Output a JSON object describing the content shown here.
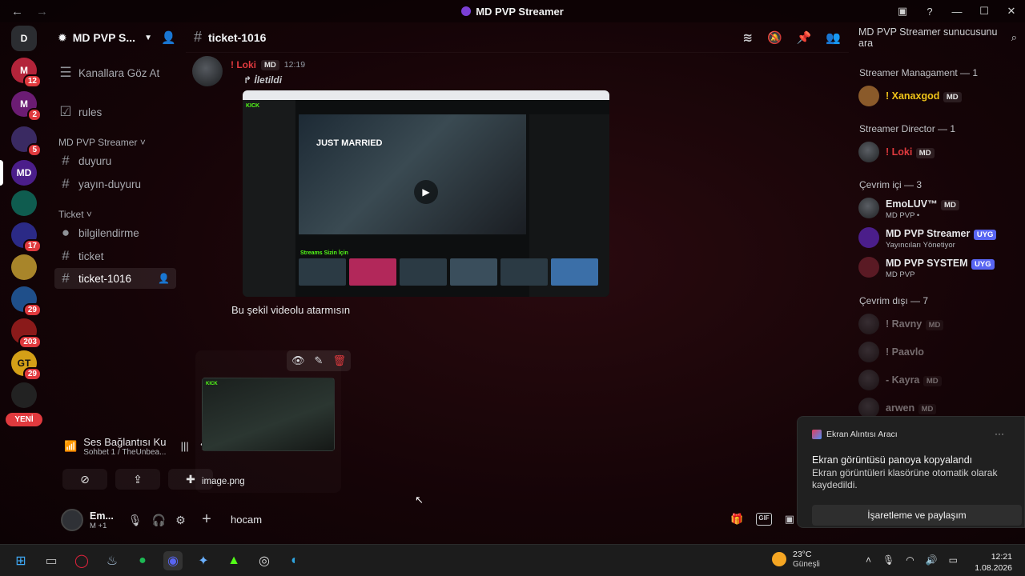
{
  "window": {
    "title": "MD PVP Streamer",
    "back_icon": "←",
    "forward_icon": "→",
    "inbox_icon": "▣",
    "help_icon": "?",
    "minimize": "—",
    "maximize": "☐",
    "close": "✕"
  },
  "rail": {
    "servers": [
      {
        "name": "server-home",
        "label": "D",
        "badge": ""
      },
      {
        "name": "server-m1",
        "label": "M",
        "badge": "12"
      },
      {
        "name": "server-m2",
        "label": "M",
        "badge": "2"
      },
      {
        "name": "server-3",
        "label": "",
        "badge": "5"
      },
      {
        "name": "server-md",
        "label": "MD",
        "badge": ""
      },
      {
        "name": "server-5",
        "label": "",
        "badge": ""
      },
      {
        "name": "server-6",
        "label": "",
        "badge": "17"
      },
      {
        "name": "server-7",
        "label": "",
        "badge": ""
      },
      {
        "name": "server-8",
        "label": "",
        "badge": "29"
      },
      {
        "name": "server-anadolu",
        "label": "",
        "badge": "203"
      },
      {
        "name": "server-gt",
        "label": "GT",
        "badge": "29"
      },
      {
        "name": "server-11",
        "label": "",
        "badge": ""
      }
    ],
    "new_label": "YENİ"
  },
  "sidebar": {
    "guild_name": "MD PVP S...",
    "browse": "Kanallara Göz At",
    "rules": "rules",
    "cat1": "MD PVP Streamer",
    "ch_duyuru": "duyuru",
    "ch_yayin": "yayın-duyuru",
    "cat2": "Ticket",
    "ch_bilgi": "bilgilendirme",
    "ch_ticket": "ticket",
    "ch_ticket1016": "ticket-1016"
  },
  "voice": {
    "title": "Ses Bağlantısı Ku",
    "subtitle": "Sohbet 1 / TheUnbea..."
  },
  "user": {
    "name": "Em...",
    "status": "M +1"
  },
  "chat": {
    "channel": "ticket-1016",
    "message": {
      "author": "! Loki",
      "tag": "MD",
      "time": "12:19",
      "forwarded": "↱ İletildi",
      "text": "Bu şekil videolu atarmısın"
    },
    "shot": {
      "brand": "KICK",
      "hero": "JUST MARRIED",
      "play": "▶",
      "streams": "Streams Sizin İçin"
    },
    "attachment": {
      "filename": "image.png",
      "brand": "KICK"
    },
    "composer": {
      "value": "hocam ",
      "plus": "+",
      "gif": "GIF"
    }
  },
  "search": {
    "placeholder": "MD PVP Streamer sunucusunu ara"
  },
  "members": {
    "cat_management": "Streamer Managament — 1",
    "m1": {
      "name": "! Xanaxgod",
      "tag": "MD"
    },
    "cat_director": "Streamer Director — 1",
    "m2": {
      "name": "! Loki",
      "tag": "MD"
    },
    "cat_online": "Çevrim içi — 3",
    "m3": {
      "name": "EmoLUV™",
      "tag": "MD",
      "sub": "MD PVP •"
    },
    "m4": {
      "name": "MD PVP Streamer",
      "tag": "UYG",
      "sub": "Yayıncıları Yönetiyor"
    },
    "m5": {
      "name": "MD PVP SYSTEM",
      "tag": "UYG",
      "sub": "MD PVP"
    },
    "cat_offline": "Çevrim dışı — 7",
    "m6": {
      "name": "! Ravny",
      "tag": "MD"
    },
    "m7": {
      "name": "! Paavlo",
      "tag": ""
    },
    "m8": {
      "name": "- Kayra",
      "tag": "MD"
    },
    "m9": {
      "name": "arwen",
      "tag": "MD"
    }
  },
  "toast": {
    "app": "Ekran Alıntısı Aracı",
    "more": "···",
    "title": "Ekran görüntüsü panoya kopyalandı",
    "body": "Ekran görüntüleri klasörüne otomatik olarak kaydedildi.",
    "button": "İşaretleme ve paylaşım"
  },
  "taskbar": {
    "weather_temp": "23°C",
    "weather_cond": "Güneşli",
    "time": "12:21",
    "date": "1.08.2026"
  }
}
